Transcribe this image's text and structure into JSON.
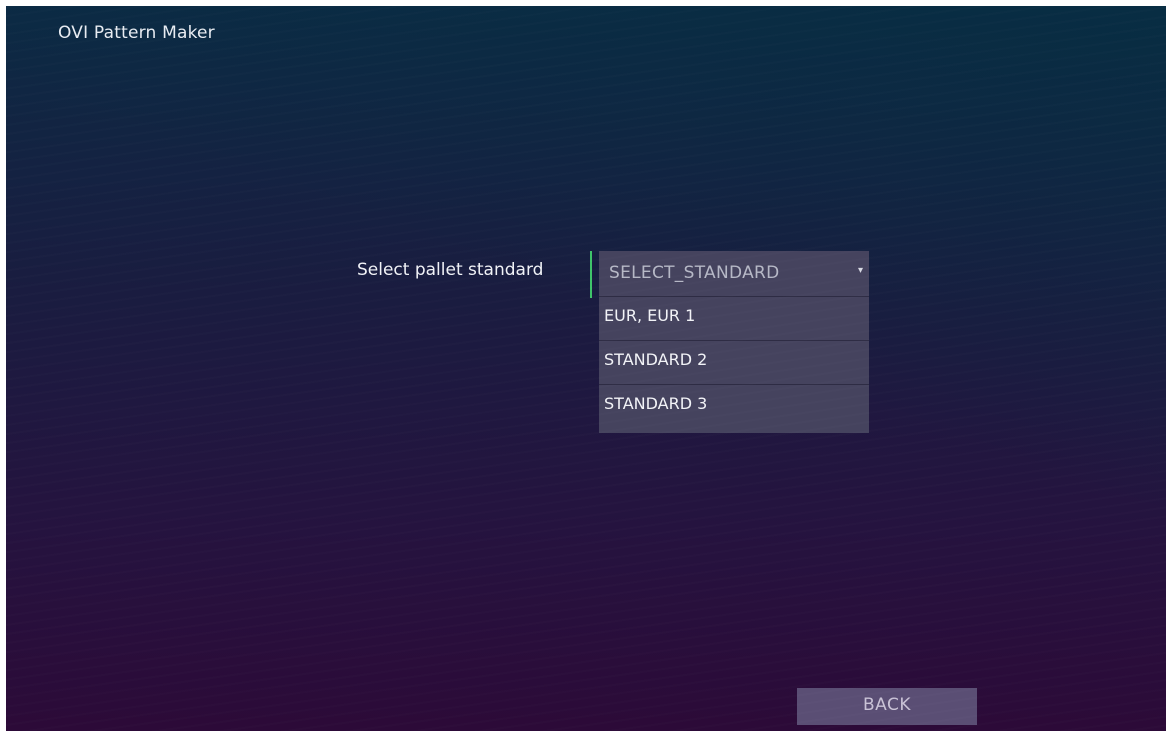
{
  "app": {
    "title": "OVI Pattern Maker"
  },
  "form": {
    "label": "Select pallet standard",
    "select": {
      "value": "SELECT_STANDARD",
      "options": [
        "EUR, EUR 1",
        "STANDARD 2",
        "STANDARD 3"
      ]
    }
  },
  "footer": {
    "back_label": "BACK"
  },
  "icons": {
    "dropdown": "chevron-down-icon"
  },
  "colors": {
    "focus_accent": "#3ec46a",
    "dropdown_bg": "#45435e",
    "back_button_bg": "#5a4e74"
  }
}
